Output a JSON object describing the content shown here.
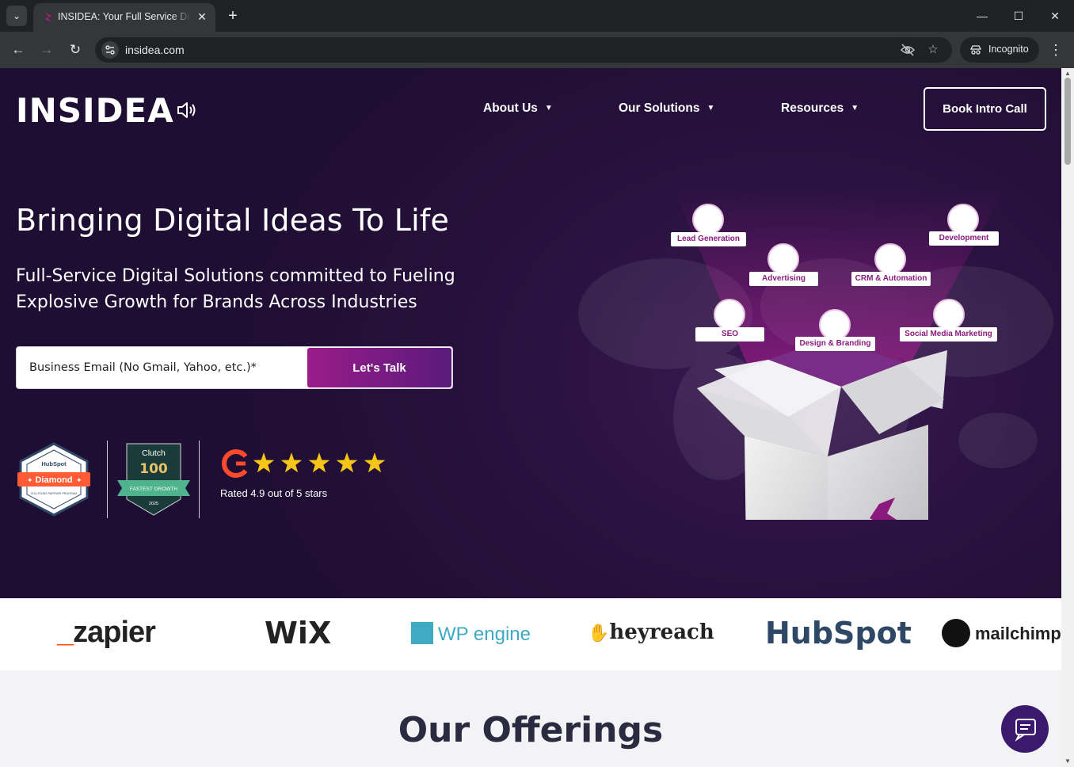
{
  "browser": {
    "tab_title": "INSIDEA: Your Full Service Digital",
    "tab_close": "✕",
    "new_tab": "+",
    "url": "insidea.com",
    "incognito_label": "Incognito",
    "window_controls": {
      "minimize": "—",
      "maximize": "☐",
      "close": "✕"
    }
  },
  "header": {
    "logo": "INSIDEA",
    "nav": [
      {
        "label": "About Us"
      },
      {
        "label": "Our Solutions"
      },
      {
        "label": "Resources"
      }
    ],
    "cta": "Book Intro Call"
  },
  "hero": {
    "title": "Bringing Digital Ideas To Life",
    "subtitle": "Full-Service Digital Solutions committed to Fueling Explosive Growth for Brands Across Industries",
    "email_placeholder": "Business Email (No Gmail, Yahoo, etc.)*",
    "submit_label": "Let's Talk",
    "hubspot_badge": {
      "brand": "HubSpot",
      "tier": "Diamond",
      "caption": "SOLUTIONS PARTNER PROGRAM"
    },
    "clutch_badge": {
      "brand": "Clutch",
      "number": "100",
      "ribbon": "FASTEST GROWTH",
      "year": "2025"
    },
    "g2": {
      "stars": 5,
      "rating_text": "Rated 4.9 out of 5 stars"
    }
  },
  "services": [
    {
      "label": "Lead Generation"
    },
    {
      "label": "Development"
    },
    {
      "label": "Advertising"
    },
    {
      "label": "CRM & Automation"
    },
    {
      "label": "SEO"
    },
    {
      "label": "Design & Branding"
    },
    {
      "label": "Social Media Marketing"
    }
  ],
  "partners": [
    "_zapier",
    "WiX",
    "WP engine",
    "heyreach",
    "HubSpot",
    "mailchimp"
  ],
  "offerings_title": "Our Offerings",
  "colors": {
    "hero_bg": "#1f0e33",
    "accent": "#9a1c8a",
    "button_gradient_end": "#5a1a7c",
    "star": "#f5c518"
  }
}
